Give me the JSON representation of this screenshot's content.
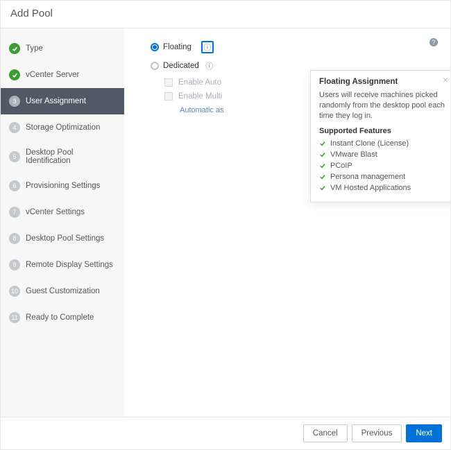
{
  "header": {
    "title": "Add Pool"
  },
  "steps": [
    {
      "label": "Type",
      "state": "done"
    },
    {
      "label": "vCenter Server",
      "state": "done"
    },
    {
      "label": "User Assignment",
      "state": "active",
      "num": "3"
    },
    {
      "label": "Storage Optimization",
      "num": "4"
    },
    {
      "label": "Desktop Pool Identification",
      "num": "5"
    },
    {
      "label": "Provisioning Settings",
      "num": "6"
    },
    {
      "label": "vCenter Settings",
      "num": "7"
    },
    {
      "label": "Desktop Pool Settings",
      "num": "8"
    },
    {
      "label": "Remote Display Settings",
      "num": "9"
    },
    {
      "label": "Guest Customization",
      "num": "10"
    },
    {
      "label": "Ready to Complete",
      "num": "11"
    }
  ],
  "options": {
    "floating": "Floating",
    "dedicated": "Dedicated",
    "enable_auto": "Enable Auto",
    "enable_multi": "Enable Multi",
    "hint": "Automatic as"
  },
  "popover": {
    "title": "Floating Assignment",
    "body": "Users will receive machines picked randomly from the desktop pool each time they log in.",
    "supported_title": "Supported Features",
    "features": [
      "Instant Clone (License)",
      "VMware Blast",
      "PCoIP",
      "Persona management",
      "VM Hosted Applications"
    ]
  },
  "footer": {
    "cancel": "Cancel",
    "previous": "Previous",
    "next": "Next"
  },
  "icons": {
    "help": "?",
    "info": "ⓘ",
    "close": "×"
  }
}
